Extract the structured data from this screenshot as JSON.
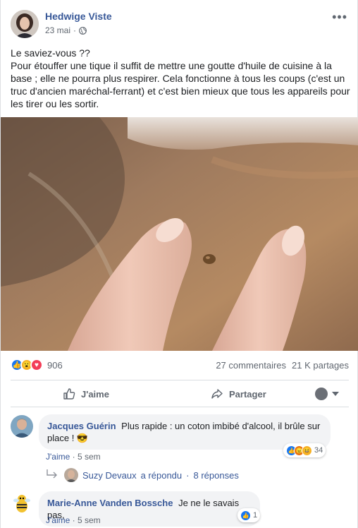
{
  "post": {
    "author": "Hedwige Viste",
    "date": "23 mai",
    "separator": "·",
    "text_line1": "Le saviez-vous ??",
    "text_line2": "Pour étouffer une tique il suffit de mettre une goutte d'huile de cuisine à la base ; elle ne pourra plus respirer. Cela fonctionne à tous les coups (c'est un truc d'ancien maréchal-ferrant) et c'est bien mieux que tous les appareils pour les tirer ou les sortir."
  },
  "reactions": {
    "count": "906",
    "comments": "27 commentaires",
    "shares": "21 K partages",
    "types": [
      "like",
      "wow",
      "love"
    ]
  },
  "actions": {
    "like_label": "J'aime",
    "share_label": "Partager"
  },
  "comments": [
    {
      "name": "Jacques Guérin",
      "text": "Plus rapide : un coton imbibé d'alcool, il brûle sur place ! 😎",
      "like_label": "J'aime",
      "time": "5 sem",
      "reaction_count": "34",
      "reaction_types": [
        "like",
        "angry",
        "haha"
      ],
      "replies": {
        "replier": "Suzy Devaux",
        "replied_text": "a répondu",
        "separator": "·",
        "count_label": "8 réponses"
      }
    },
    {
      "name": "Marie-Anne Vanden Bossche",
      "text": "Je ne le savais pas,",
      "like_label": "J'aime",
      "time": "5 sem",
      "reaction_count": "1",
      "reaction_types": [
        "like"
      ]
    }
  ],
  "colors": {
    "link": "#385898",
    "like_blue": "#1877f2",
    "love_red": "#f33e58",
    "wow_yellow": "#f7b125",
    "angry_orange": "#e9710f",
    "muted": "#606770"
  }
}
